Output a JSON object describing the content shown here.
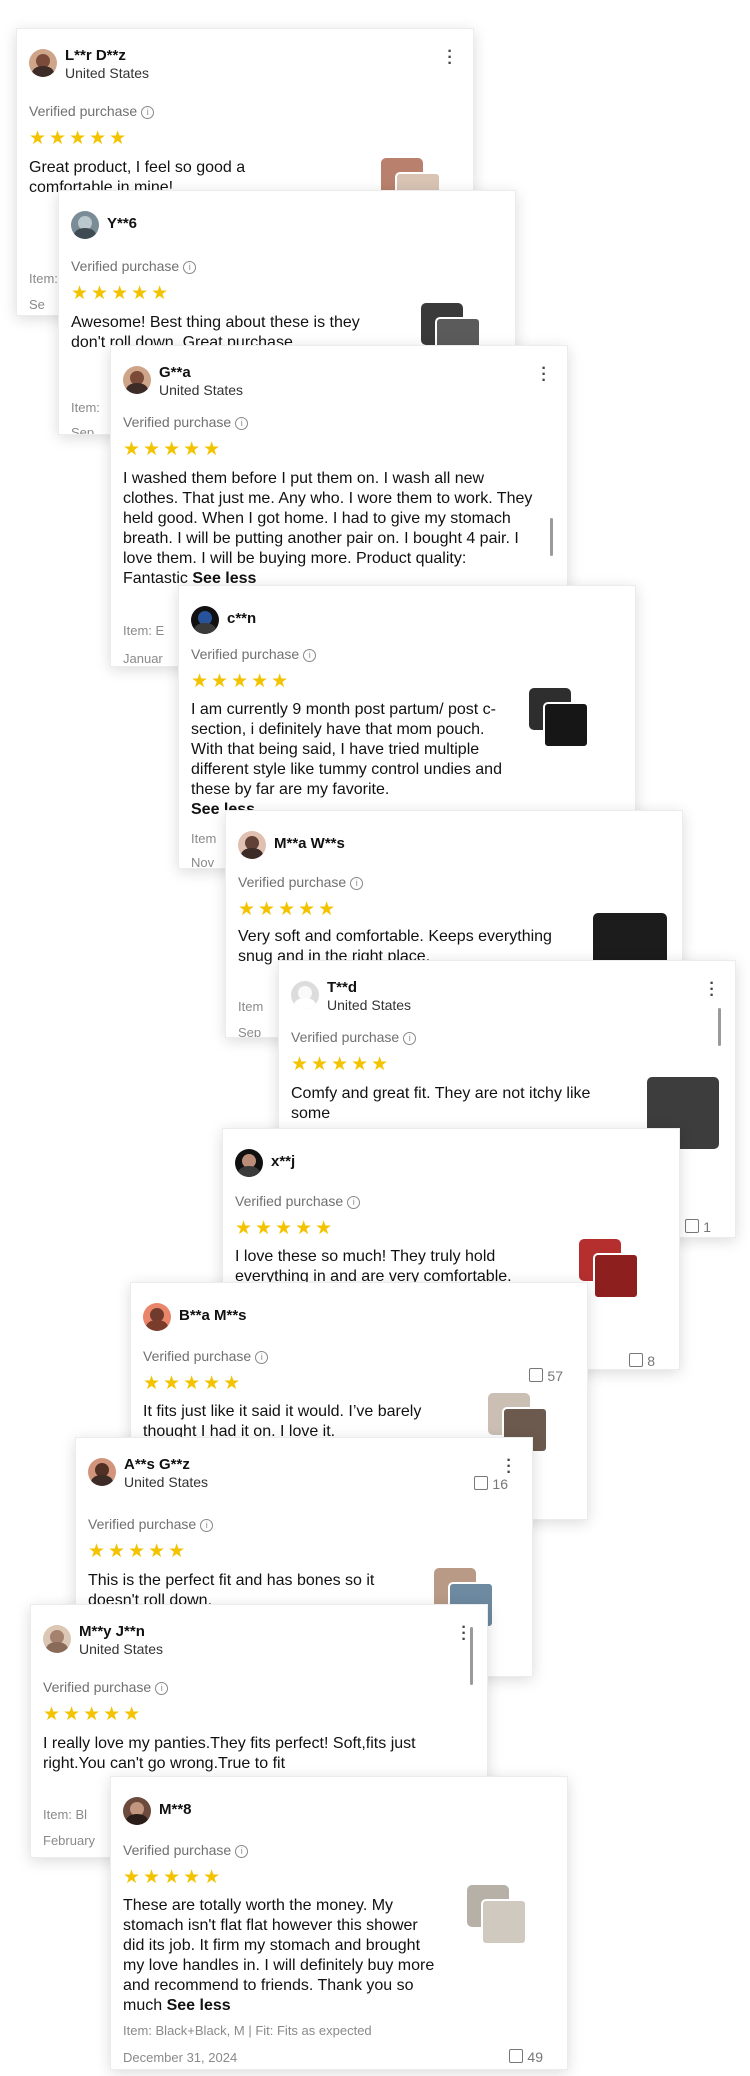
{
  "reviews": [
    {
      "user": "L**r D**z",
      "country": "United States",
      "verified": "Verified purchase",
      "stars": "★★★★★",
      "text": "Great product, I feel so good a comfortable in mine!",
      "item": "Item:",
      "date": "Se"
    },
    {
      "user": "Y**6",
      "verified": "Verified purchase",
      "stars": "★★★★★",
      "text": "Awesome! Best thing about these is they don't roll down. Great purchase.",
      "item": "Item:",
      "date": "Sep"
    },
    {
      "user": "G**a",
      "country": "United States",
      "verified": "Verified purchase",
      "stars": "★★★★★",
      "text": "I washed them before I put them on. I wash all new clothes. That just me. Any who. I wore them to work. They held good. When I got home. I had to give my stomach breath. I will be putting another pair on. I bought 4 pair. I love them. I will be buying more. Product quality: Fantastic",
      "see_less": "See less",
      "item": "Item: E",
      "date": "Januar"
    },
    {
      "user": "c**n",
      "verified": "Verified purchase",
      "stars": "★★★★★",
      "text": "I am currently 9 month post partum/ post c-section, i definitely have that mom pouch. With that being said, I have tried multiple different style like tummy control undies and these by far are my favorite.",
      "see_less": "See less",
      "item": "Item",
      "date": "Nov"
    },
    {
      "user": "M**a W**s",
      "verified": "Verified purchase",
      "stars": "★★★★★",
      "text": "Very soft and comfortable. Keeps everything snug and in the right place.",
      "item": "Item",
      "date": "Sep"
    },
    {
      "user": "T**d",
      "country": "United States",
      "verified": "Verified purchase",
      "stars": "★★★★★",
      "text": "Comfy and great fit. They are not itchy like some",
      "likes": "1"
    },
    {
      "user": "x**j",
      "verified": "Verified purchase",
      "stars": "★★★★★",
      "text": "I love these so much! They truly hold everything in and are very comfortable.",
      "likes": "8"
    },
    {
      "user": "B**a M**s",
      "verified": "Verified purchase",
      "stars": "★★★★★",
      "text": "It fits just like it said it would. I’ve barely thought I had it on. I love it.",
      "likes": "57"
    },
    {
      "user": "A**s G**z",
      "country": "United States",
      "verified": "Verified purchase",
      "stars": "★★★★★",
      "text": "This is the perfect fit and has bones so it doesn't roll down.",
      "likes": "16"
    },
    {
      "user": "M**y J**n",
      "country": "United States",
      "verified": "Verified purchase",
      "stars": "★★★★★",
      "text": "I really love my panties.They fits perfect! Soft,fits just right.You can't go wrong.True to fit",
      "item": "Item: Bl",
      "date": "February"
    },
    {
      "user": "M**8",
      "verified": "Verified purchase",
      "stars": "★★★★★",
      "text": "These are totally worth the money. My stomach isn't flat flat however this shower did its job. It firm my stomach and brought my love handles in. I will definitely buy more and recommend to friends. Thank you so much",
      "see_less": "See less",
      "item": "Item: Black+Black, M | Fit: Fits as expected",
      "date": "December 31, 2024",
      "likes": "49"
    }
  ],
  "colors": {
    "star": "#f4c300",
    "muted": "#707070"
  }
}
